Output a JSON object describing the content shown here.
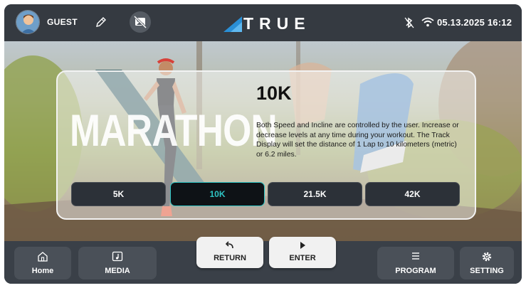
{
  "header": {
    "user_name": "GUEST",
    "brand": "TRUE",
    "datetime": "05.13.2025 16:12",
    "icons": {
      "avatar": "user-avatar",
      "edit": "pencil-icon",
      "media_off": "no-image-icon",
      "bluetooth": "bluetooth-off-icon",
      "wifi": "wifi-icon"
    }
  },
  "program": {
    "banner_text": "MARATHON",
    "title": "10K",
    "description": "Both Speed and Incline are controlled by the user. Increase or decrease levels at any time during your workout. The Track Display will set the distance of 1 Lap to 10 kilometers (metric) or 6.2 miles.",
    "distances": [
      {
        "label": "5K",
        "selected": false
      },
      {
        "label": "10K",
        "selected": true
      },
      {
        "label": "21.5K",
        "selected": false
      },
      {
        "label": "42K",
        "selected": false
      }
    ]
  },
  "actions": {
    "return_label": "RETURN",
    "enter_label": "ENTER"
  },
  "footer": {
    "home_label": "Home",
    "media_label": "MEDIA",
    "program_label": "PROGRAM",
    "setting_label": "SETTING"
  },
  "colors": {
    "bar_bg": "#353a41",
    "accent": "#2ec4c4",
    "logo_blue": "#2a8fd6"
  }
}
